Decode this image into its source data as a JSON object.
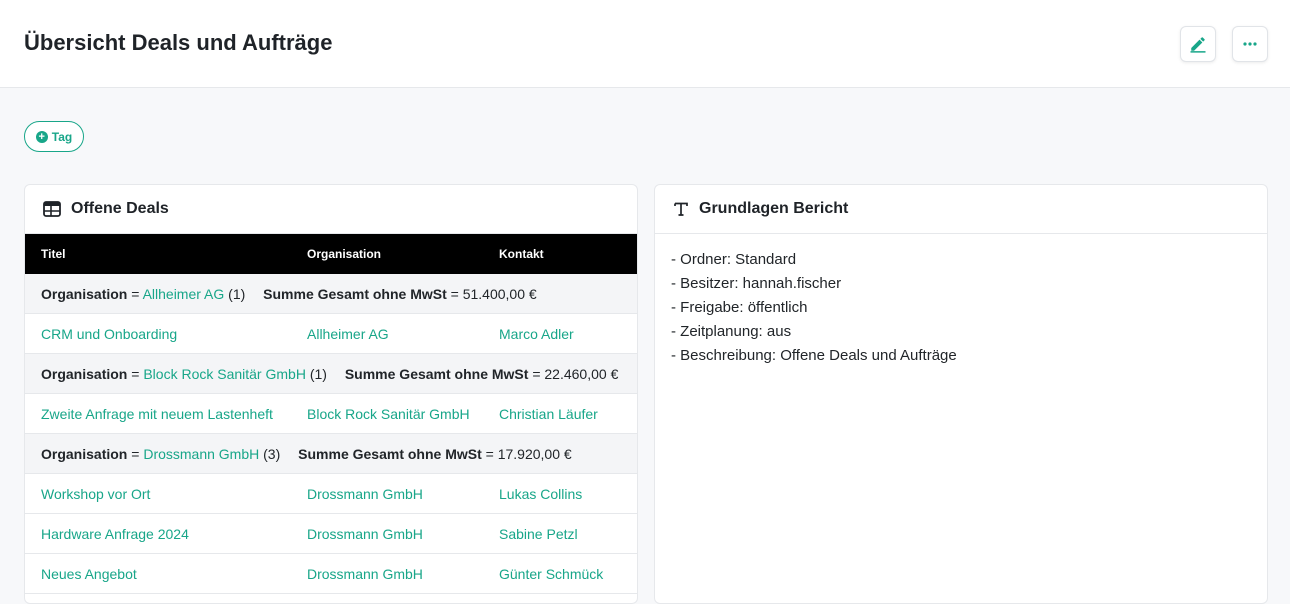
{
  "header": {
    "title": "Übersicht Deals und Aufträge",
    "edit_icon": "pencil-icon",
    "more_icon": "more-dots-icon"
  },
  "tag_button": {
    "label": "Tag",
    "icon": "plus-circle-icon"
  },
  "colors": {
    "accent": "#18a689",
    "table_header_bg": "#000000",
    "group_bg": "#f4f5f7"
  },
  "deals_card": {
    "title": "Offene Deals",
    "icon": "table-icon",
    "columns": [
      "Titel",
      "Organisation",
      "Kontakt"
    ],
    "groups": [
      {
        "label": "Organisation",
        "op": "=",
        "value": "Allheimer AG",
        "count": "(1)",
        "sum_label": "Summe Gesamt ohne MwSt",
        "sum_value": "= 51.400,00 €",
        "rows": [
          {
            "titel": "CRM und Onboarding",
            "organisation": "Allheimer AG",
            "kontakt": "Marco Adler"
          }
        ]
      },
      {
        "label": "Organisation",
        "op": "=",
        "value": "Block Rock Sanitär GmbH",
        "count": "(1)",
        "sum_label": "Summe Gesamt ohne MwSt",
        "sum_value": "= 22.460,00 €",
        "rows": [
          {
            "titel": "Zweite Anfrage mit neuem Lastenheft",
            "organisation": "Block Rock Sanitär GmbH",
            "kontakt": "Christian Läufer"
          }
        ]
      },
      {
        "label": "Organisation",
        "op": "=",
        "value": "Drossmann GmbH",
        "count": "(3)",
        "sum_label": "Summe Gesamt ohne MwSt",
        "sum_value": "= 17.920,00 €",
        "rows": [
          {
            "titel": "Workshop vor Ort",
            "organisation": "Drossmann GmbH",
            "kontakt": "Lukas Collins"
          },
          {
            "titel": "Hardware Anfrage 2024",
            "organisation": "Drossmann GmbH",
            "kontakt": "Sabine Petzl"
          },
          {
            "titel": "Neues Angebot",
            "organisation": "Drossmann GmbH",
            "kontakt": "Günter Schmück"
          }
        ]
      }
    ]
  },
  "report_card": {
    "title": "Grundlagen Bericht",
    "icon": "text-icon",
    "lines": [
      "- Ordner: Standard",
      "- Besitzer: hannah.fischer",
      "- Freigabe: öffentlich",
      "- Zeitplanung: aus",
      "- Beschreibung: Offene Deals und Aufträge"
    ]
  }
}
